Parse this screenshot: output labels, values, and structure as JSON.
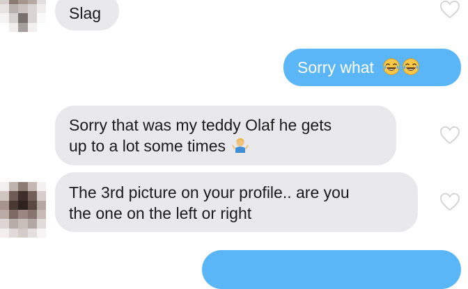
{
  "messages": [
    {
      "direction": "incoming",
      "text": "Slag"
    },
    {
      "direction": "outgoing",
      "text": "Sorry what",
      "emoji": [
        "face-with-tears-of-joy",
        "face-with-tears-of-joy"
      ]
    },
    {
      "direction": "incoming",
      "line1": "Sorry that was my teddy Olaf he gets",
      "line2": "up to a lot some times",
      "emoji": [
        "person-shrugging"
      ]
    },
    {
      "direction": "incoming",
      "line1": "The 3rd picture on your profile.. are you",
      "line2": "the one on the left or right"
    },
    {
      "direction": "outgoing",
      "text": ""
    }
  ],
  "colors": {
    "incoming_bubble": "#e9e9eb",
    "outgoing_bubble": "#5ab6f6",
    "heart_outline": "#d3d3d3"
  },
  "icons": [
    "heart-outline-icon",
    "avatar-pixelated"
  ]
}
